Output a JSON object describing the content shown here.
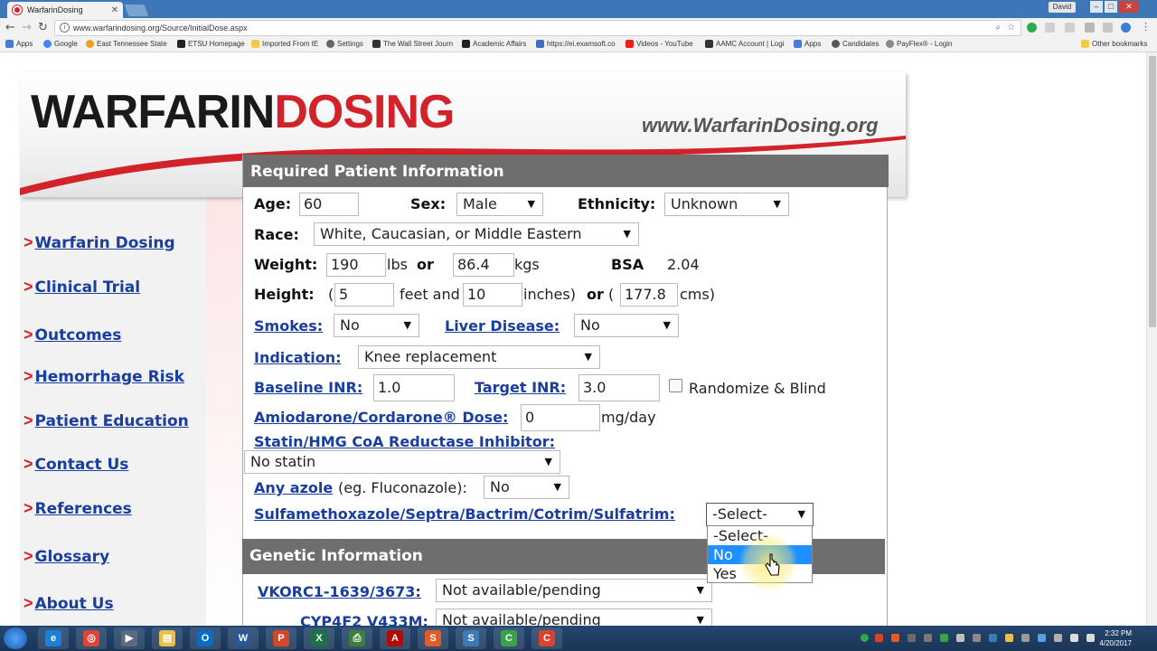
{
  "browser": {
    "tab_title": "WarfarinDosing",
    "tab_close": "✕",
    "user_label": "David",
    "url": "www.warfarindosing.org/Source/InitialDose.aspx",
    "bookmarks": [
      {
        "label": "Apps",
        "color": "#4a7bd4"
      },
      {
        "label": "Google",
        "color": "#4285f4"
      },
      {
        "label": "East Tennessee State",
        "color": "#e8a21a"
      },
      {
        "label": "ETSU Homepage",
        "color": "#222222"
      },
      {
        "label": "Imported From IE",
        "color": "#f2c94c"
      },
      {
        "label": "Settings",
        "color": "#666666"
      },
      {
        "label": "The Wall Street Journ",
        "color": "#333333"
      },
      {
        "label": "Academic Affairs",
        "color": "#222222"
      },
      {
        "label": "https://ei.examsoft.co",
        "color": "#3b6fc2"
      },
      {
        "label": "Videos - YouTube",
        "color": "#e62117"
      },
      {
        "label": "AAMC Account | Logi",
        "color": "#333333"
      },
      {
        "label": "Apps",
        "color": "#4a7bd4"
      },
      {
        "label": "Candidates",
        "color": "#555555"
      },
      {
        "label": "PayFlex® - Login",
        "color": "#888888"
      }
    ],
    "other_bookmarks": "Other bookmarks"
  },
  "header": {
    "logo_part1": "WARFARIN",
    "logo_part2": "DOSING",
    "site_url": "www.WarfarinDosing.org"
  },
  "sidebar": {
    "arrow": ">",
    "items": [
      {
        "label": "Warfarin Dosing"
      },
      {
        "label": "Clinical Trial"
      },
      {
        "label": "Outcomes"
      },
      {
        "label": "Hemorrhage Risk"
      },
      {
        "label": "Patient Education"
      },
      {
        "label": "Contact Us"
      },
      {
        "label": "References"
      },
      {
        "label": "Glossary"
      },
      {
        "label": "About Us"
      }
    ]
  },
  "form": {
    "section_title": "Required Patient Information",
    "age_label": "Age:",
    "age_value": "60",
    "sex_label": "Sex:",
    "sex_value": "Male",
    "ethnicity_label": "Ethnicity:",
    "ethnicity_value": "Unknown",
    "race_label": "Race:",
    "race_value": "White, Caucasian, or Middle Eastern",
    "weight_label": "Weight:",
    "weight_lbs": "190",
    "lbs_unit": "lbs",
    "or": "or",
    "weight_kgs": "86.4",
    "kgs_unit": "kgs",
    "bsa_label": "BSA",
    "bsa_value": "2.04",
    "height_label": "Height:",
    "paren_open": "(",
    "height_feet": "5",
    "feet_and": "feet and",
    "height_inches": "10",
    "inches_close": "inches)",
    "or2": "or",
    "paren_open2": "(",
    "height_cms": "177.8",
    "cms_close": "cms)",
    "smokes_label": "Smokes:",
    "smokes_value": "No",
    "liver_label": "Liver Disease:",
    "liver_value": "No",
    "indication_label": "Indication:",
    "indication_value": "Knee replacement",
    "baseline_inr_label": "Baseline INR:",
    "baseline_inr_value": "1.0",
    "target_inr_label": "Target INR:",
    "target_inr_value": "3.0",
    "randomize_label": "Randomize & Blind",
    "amiodarone_label": "Amiodarone/Cordarone® Dose:",
    "amiodarone_value": "0",
    "amiodarone_unit": "mg/day",
    "statin_label": "Statin/HMG CoA Reductase Inhibitor:",
    "statin_value": "No statin",
    "azole_label": "Any azole",
    "azole_example": "(eg. Fluconazole):",
    "azole_value": "No",
    "sulfa_label": "Sulfamethoxazole/Septra/Bactrim/Cotrim/Sulfatrim:",
    "sulfa_value": "-Select-",
    "sulfa_options": [
      "-Select-",
      "No",
      "Yes"
    ]
  },
  "genetic": {
    "section_title": "Genetic Information",
    "vkorc1_label": "VKORC1-1639/3673:",
    "vkorc1_value": "Not available/pending",
    "cyp4f2_label": "CYP4F2 V433M:",
    "cyp4f2_value": "Not available/pending"
  },
  "taskbar": {
    "time": "2:32 PM",
    "date": "4/20/2017",
    "apps": [
      {
        "letter": "e",
        "color": "#1e7fd6"
      },
      {
        "letter": "◎",
        "color": "#db4437"
      },
      {
        "letter": "▶",
        "color": "#5a6a80"
      },
      {
        "letter": "▤",
        "color": "#e8c04a"
      },
      {
        "letter": "O",
        "color": "#0a6cc5"
      },
      {
        "letter": "W",
        "color": "#2b5797"
      },
      {
        "letter": "P",
        "color": "#d24726"
      },
      {
        "letter": "X",
        "color": "#1e7145"
      },
      {
        "letter": "⎙",
        "color": "#3d7f3d"
      },
      {
        "letter": "A",
        "color": "#b30b00"
      },
      {
        "letter": "S",
        "color": "#e35b2b"
      },
      {
        "letter": "S",
        "color": "#3b7bb8"
      },
      {
        "letter": "C",
        "color": "#3aa24a"
      },
      {
        "letter": "C",
        "color": "#d9432c"
      }
    ]
  }
}
